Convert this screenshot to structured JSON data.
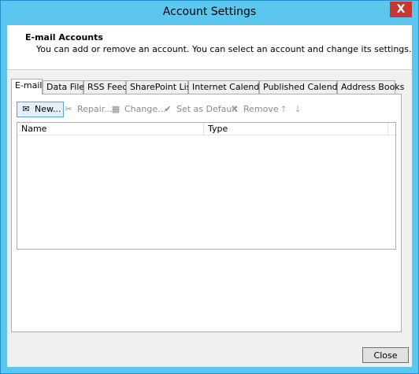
{
  "window": {
    "title": "Account Settings",
    "close_glyph": "X"
  },
  "header": {
    "title": "E-mail Accounts",
    "description": "You can add or remove an account. You can select an account and change its settings."
  },
  "tabs": [
    {
      "label": "E-mail",
      "active": true
    },
    {
      "label": "Data Files"
    },
    {
      "label": "RSS Feeds"
    },
    {
      "label": "SharePoint Lists"
    },
    {
      "label": "Internet Calendars"
    },
    {
      "label": "Published Calendars"
    },
    {
      "label": "Address Books"
    }
  ],
  "toolbar": {
    "new": "New...",
    "repair": "Repair...",
    "change": "Change...",
    "set_default": "Set as Default",
    "remove": "Remove"
  },
  "list": {
    "columns": [
      "Name",
      "Type"
    ]
  },
  "footer": {
    "close_label": "Close"
  }
}
